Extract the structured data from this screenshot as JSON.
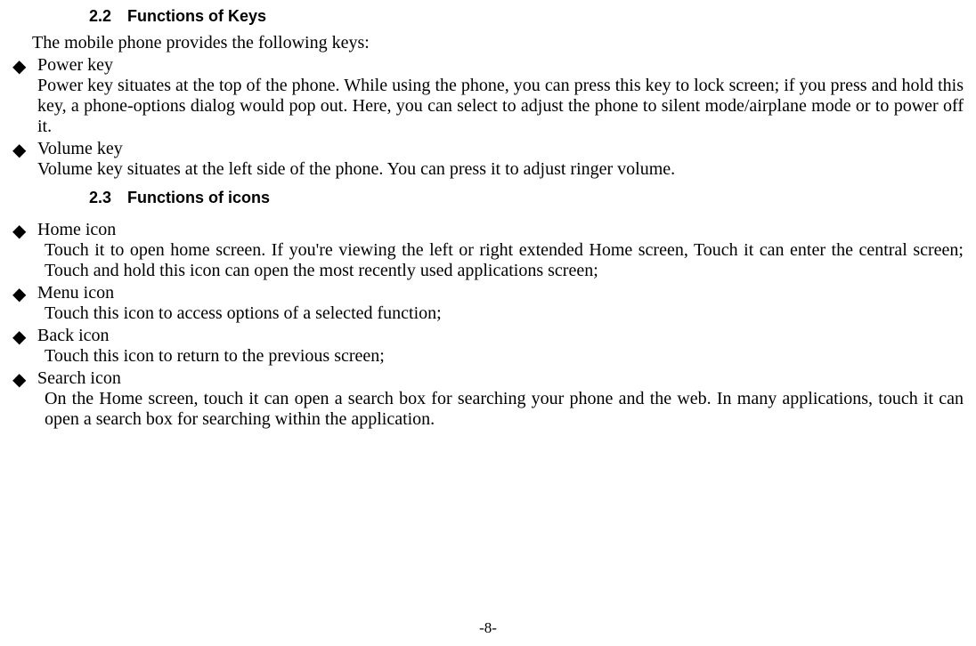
{
  "section22": {
    "num": "2.2",
    "title": "Functions of Keys",
    "intro": "The mobile phone provides the following keys:",
    "items": [
      {
        "title": "Power key",
        "body": "Power key situates at the top of the phone. While using the phone, you can press this key to lock screen; if you press and hold this key, a phone-options dialog would pop out. Here, you can select to adjust the phone to silent mode/airplane mode or to power off it."
      },
      {
        "title": "Volume key",
        "body": "Volume key situates at the left side of the phone. You can press it to adjust ringer volume."
      }
    ]
  },
  "section23": {
    "num": "2.3",
    "title": "Functions of icons",
    "items": [
      {
        "title": "Home icon",
        "body": "Touch it to open home screen. If you're viewing the left or right extended Home screen, Touch it can enter the central screen; Touch and hold this icon can open the most recently used applications screen;"
      },
      {
        "title": "Menu icon",
        "body": "Touch this icon to access options of a selected function;"
      },
      {
        "title": "Back icon",
        "body": "Touch this icon to return to the previous screen;"
      },
      {
        "title": "Search icon",
        "body": "On the Home screen, touch it can open a search box for searching your phone and the web. In many applications, touch it can open a search box for searching within the application."
      }
    ]
  },
  "pageNumber": "-8-",
  "bulletGlyph": "◆"
}
